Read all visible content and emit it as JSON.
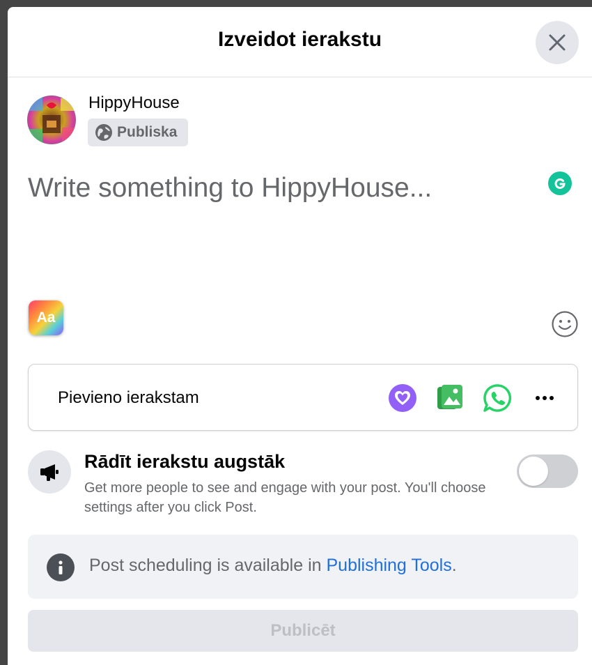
{
  "dialog": {
    "title": "Izveidot ierakstu",
    "close_icon": "close-icon"
  },
  "author": {
    "name": "HippyHouse",
    "privacy_label": "Publiska",
    "privacy_icon": "globe-icon"
  },
  "composer": {
    "placeholder": "Write something to HippyHouse...",
    "value": ""
  },
  "add_to_post": {
    "label": "Pievieno ierakstam",
    "icons": [
      "heart-chat-icon",
      "photo-icon",
      "whatsapp-icon",
      "more-icon"
    ]
  },
  "boost": {
    "title": "Rādīt ierakstu augstāk",
    "description": "Get more people to see and engage with your post. You'll choose settings after you click Post.",
    "enabled": false
  },
  "info": {
    "text": "Post scheduling is available in ",
    "link": "Publishing Tools",
    "suffix": "."
  },
  "publish": {
    "label": "Publicēt"
  },
  "colors": {
    "accent_link": "#216fdb",
    "purple_icon": "#9360f7",
    "green_icon": "#45bd62",
    "whatsapp": "#25d366",
    "grammarly": "#15c39a"
  }
}
